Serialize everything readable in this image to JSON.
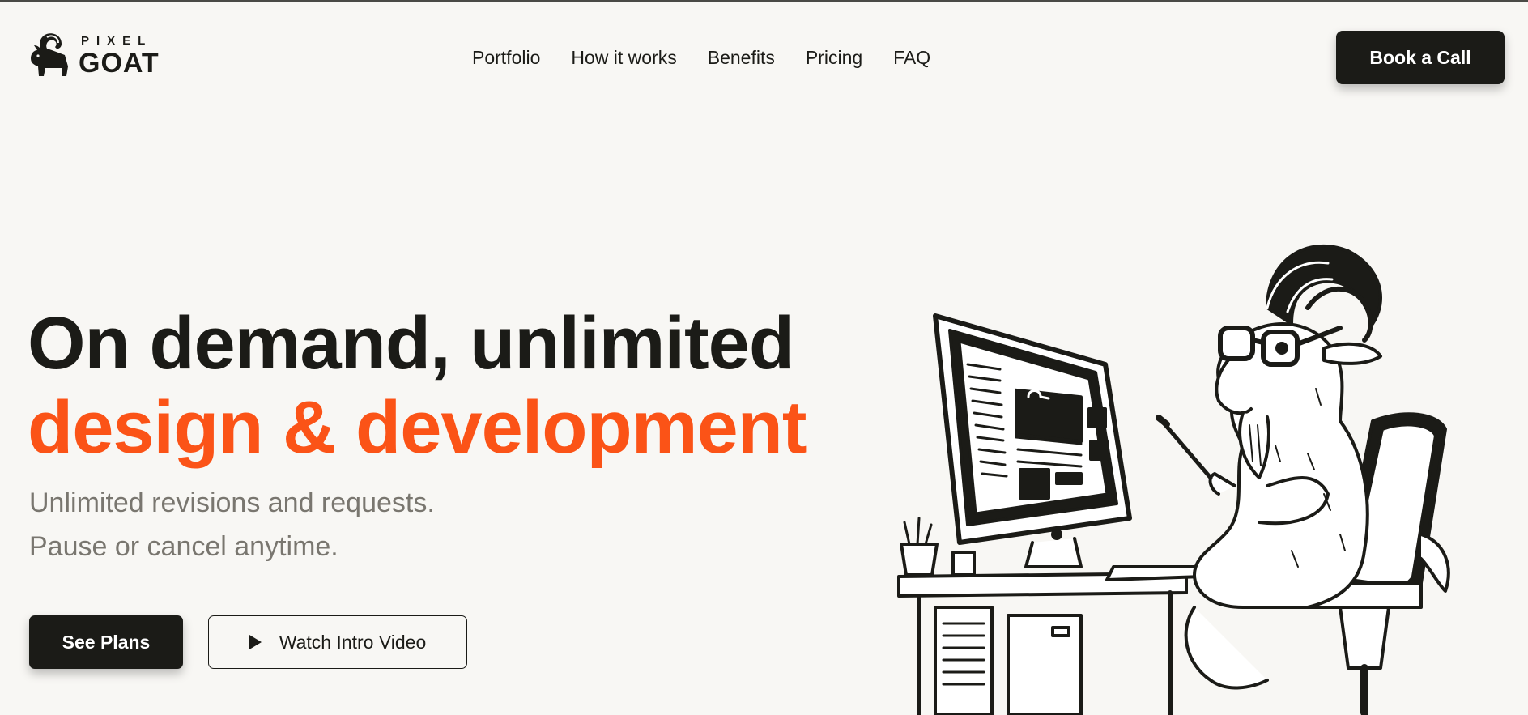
{
  "brand": {
    "top": "PIXEL",
    "bottom": "GOAT",
    "logo_icon": "goat-head-icon"
  },
  "nav": {
    "items": [
      {
        "label": "Portfolio"
      },
      {
        "label": "How it works"
      },
      {
        "label": "Benefits"
      },
      {
        "label": "Pricing"
      },
      {
        "label": "FAQ"
      }
    ]
  },
  "header": {
    "cta_label": "Book a Call"
  },
  "hero": {
    "title_line1": "On demand, unlimited",
    "title_line2": "design & development",
    "subtitle_line1": "Unlimited revisions and requests.",
    "subtitle_line2": "Pause or cancel anytime.",
    "primary_label": "See Plans",
    "secondary_label": "Watch Intro Video",
    "secondary_icon": "play-icon",
    "illustration": "goat-at-computer-illustration"
  },
  "colors": {
    "accent": "#fb5317",
    "dark": "#1b1b17",
    "muted": "#79766f",
    "background": "#f8f7f4"
  }
}
